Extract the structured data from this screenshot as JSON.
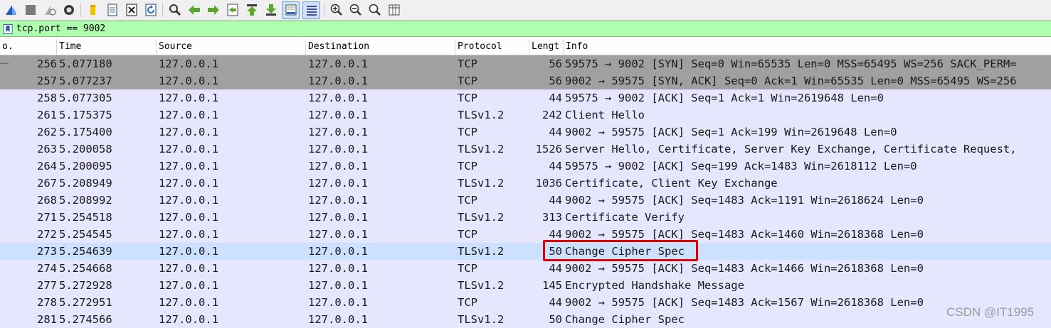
{
  "toolbar": {
    "buttons": [
      "shark-fin-icon",
      "stop-icon",
      "restart-icon",
      "options-icon",
      "open-icon",
      "file-icon",
      "close-file-icon",
      "reload-icon",
      "find-icon",
      "back-icon",
      "forward-icon",
      "goto-icon",
      "first-icon",
      "last-icon",
      "autoscroll-icon",
      "colorize-icon",
      "zoom-in-icon",
      "zoom-out-icon",
      "zoom-normal-icon",
      "resize-columns-icon"
    ]
  },
  "filter": {
    "value": "tcp.port == 9002"
  },
  "columns": {
    "no": "o.",
    "time": "Time",
    "source": "Source",
    "destination": "Destination",
    "protocol": "Protocol",
    "length": "Lengt",
    "info": "Info"
  },
  "packets": [
    {
      "no": "256",
      "time": "5.077180",
      "source": "127.0.0.1",
      "destination": "127.0.0.1",
      "protocol": "TCP",
      "length": "56",
      "info": "59575 → 9002 [SYN] Seq=0 Win=65535 Len=0 MSS=65495 WS=256 SACK_PERM=",
      "style": "gray"
    },
    {
      "no": "257",
      "time": "5.077237",
      "source": "127.0.0.1",
      "destination": "127.0.0.1",
      "protocol": "TCP",
      "length": "56",
      "info": "9002 → 59575 [SYN, ACK] Seq=0 Ack=1 Win=65535 Len=0 MSS=65495 WS=256",
      "style": "gray"
    },
    {
      "no": "258",
      "time": "5.077305",
      "source": "127.0.0.1",
      "destination": "127.0.0.1",
      "protocol": "TCP",
      "length": "44",
      "info": "59575 → 9002 [ACK] Seq=1 Ack=1 Win=2619648 Len=0",
      "style": "lav"
    },
    {
      "no": "261",
      "time": "5.175375",
      "source": "127.0.0.1",
      "destination": "127.0.0.1",
      "protocol": "TLSv1.2",
      "length": "242",
      "info": "Client Hello",
      "style": "lav"
    },
    {
      "no": "262",
      "time": "5.175400",
      "source": "127.0.0.1",
      "destination": "127.0.0.1",
      "protocol": "TCP",
      "length": "44",
      "info": "9002 → 59575 [ACK] Seq=1 Ack=199 Win=2619648 Len=0",
      "style": "lav"
    },
    {
      "no": "263",
      "time": "5.200058",
      "source": "127.0.0.1",
      "destination": "127.0.0.1",
      "protocol": "TLSv1.2",
      "length": "1526",
      "info": "Server Hello, Certificate, Server Key Exchange, Certificate Request,",
      "style": "lav"
    },
    {
      "no": "264",
      "time": "5.200095",
      "source": "127.0.0.1",
      "destination": "127.0.0.1",
      "protocol": "TCP",
      "length": "44",
      "info": "59575 → 9002 [ACK] Seq=199 Ack=1483 Win=2618112 Len=0",
      "style": "lav"
    },
    {
      "no": "267",
      "time": "5.208949",
      "source": "127.0.0.1",
      "destination": "127.0.0.1",
      "protocol": "TLSv1.2",
      "length": "1036",
      "info": "Certificate, Client Key Exchange",
      "style": "lav"
    },
    {
      "no": "268",
      "time": "5.208992",
      "source": "127.0.0.1",
      "destination": "127.0.0.1",
      "protocol": "TCP",
      "length": "44",
      "info": "9002 → 59575 [ACK] Seq=1483 Ack=1191 Win=2618624 Len=0",
      "style": "lav"
    },
    {
      "no": "271",
      "time": "5.254518",
      "source": "127.0.0.1",
      "destination": "127.0.0.1",
      "protocol": "TLSv1.2",
      "length": "313",
      "info": "Certificate Verify",
      "style": "lav"
    },
    {
      "no": "272",
      "time": "5.254545",
      "source": "127.0.0.1",
      "destination": "127.0.0.1",
      "protocol": "TCP",
      "length": "44",
      "info": "9002 → 59575 [ACK] Seq=1483 Ack=1460 Win=2618368 Len=0",
      "style": "lav"
    },
    {
      "no": "273",
      "time": "5.254639",
      "source": "127.0.0.1",
      "destination": "127.0.0.1",
      "protocol": "TLSv1.2",
      "length": "50",
      "info": "Change Cipher Spec",
      "style": "sel"
    },
    {
      "no": "274",
      "time": "5.254668",
      "source": "127.0.0.1",
      "destination": "127.0.0.1",
      "protocol": "TCP",
      "length": "44",
      "info": "9002 → 59575 [ACK] Seq=1483 Ack=1466 Win=2618368 Len=0",
      "style": "lav"
    },
    {
      "no": "277",
      "time": "5.272928",
      "source": "127.0.0.1",
      "destination": "127.0.0.1",
      "protocol": "TLSv1.2",
      "length": "145",
      "info": "Encrypted Handshake Message",
      "style": "lav"
    },
    {
      "no": "278",
      "time": "5.272951",
      "source": "127.0.0.1",
      "destination": "127.0.0.1",
      "protocol": "TCP",
      "length": "44",
      "info": "9002 → 59575 [ACK] Seq=1483 Ack=1567 Win=2618368 Len=0",
      "style": "lav"
    },
    {
      "no": "281",
      "time": "5.274566",
      "source": "127.0.0.1",
      "destination": "127.0.0.1",
      "protocol": "TLSv1.2",
      "length": "50",
      "info": "Change Cipher Spec",
      "style": "lav"
    }
  ],
  "watermark": "CSDN @IT1995",
  "colors": {
    "gray_row": "#a0a0a0",
    "lavender_row": "#e7e6ff",
    "selected_row": "#cce0ff",
    "filter_bg": "#afffaf",
    "highlight": "#e00000"
  }
}
